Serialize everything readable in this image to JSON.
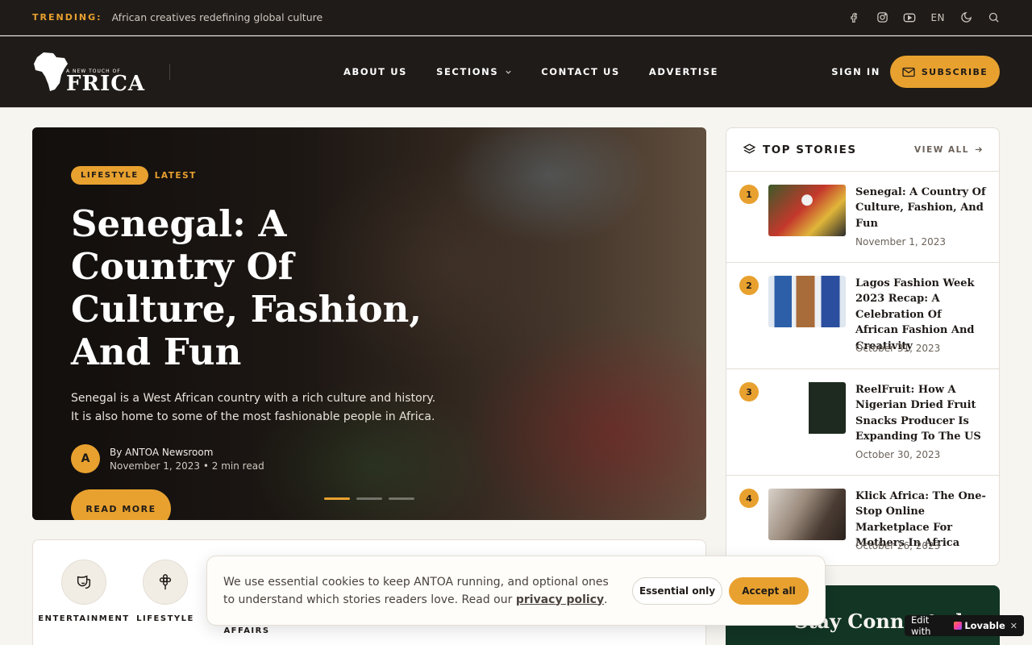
{
  "trending": {
    "label": "TRENDING:",
    "text": "African creatives redefining global culture",
    "lang": "EN"
  },
  "header": {
    "logo_small": "A NEW TOUCH OF",
    "logo_word": "FRICA",
    "nav": [
      "ABOUT US",
      "SECTIONS",
      "CONTACT US",
      "ADVERTISE"
    ],
    "signin": "SIGN IN",
    "subscribe": "SUBSCRIBE"
  },
  "hero": {
    "tag_category": "LIFESTYLE",
    "tag_latest": "LATEST",
    "title": "Senegal: A Country Of Culture, Fashion, And Fun",
    "description": "Senegal is a West African country with a rich culture and history. It is also home to some of the most fashionable people in Africa.",
    "avatar_initial": "A",
    "author": "By ANTOA Newsroom",
    "date": "November 1, 2023",
    "read_time": "2 min read",
    "read_more": "READ MORE",
    "slides": 3,
    "active_slide": 1
  },
  "categories": [
    {
      "label": "ENTERTAINMENT",
      "icon": "theater-mask-icon"
    },
    {
      "label": "LIFESTYLE",
      "icon": "flower-icon"
    },
    {
      "label": "AFFAIRS",
      "icon": "globe-icon"
    }
  ],
  "top_stories": {
    "title": "TOP STORIES",
    "view_all": "VIEW ALL",
    "items": [
      {
        "rank": "1",
        "title": "Senegal: A Country Of Culture, Fashion, And Fun",
        "date": "November 1, 2023"
      },
      {
        "rank": "2",
        "title": "Lagos Fashion Week 2023 Recap: A Celebration Of African Fashion And Creativity",
        "date": "October 31, 2023"
      },
      {
        "rank": "3",
        "title": "ReelFruit: How A Nigerian Dried Fruit Snacks Producer Is Expanding To The US",
        "date": "October 30, 2023"
      },
      {
        "rank": "4",
        "title": "Klick Africa: The One-Stop Online Marketplace For Mothers In Africa",
        "date": "October 26, 2023"
      }
    ]
  },
  "connected": {
    "title": "Stay Connected"
  },
  "cookie": {
    "text": "We use essential cookies to keep ANTOA running, and optional ones to understand which stories readers love. Read our ",
    "link": "privacy policy",
    "end": ".",
    "essential": "Essential only",
    "accept": "Accept all"
  },
  "badge": {
    "edit": "Edit with",
    "brand": "Lovable"
  },
  "colors": {
    "accent": "#e8a12f",
    "dark": "#1f1b18",
    "green": "#123524"
  }
}
